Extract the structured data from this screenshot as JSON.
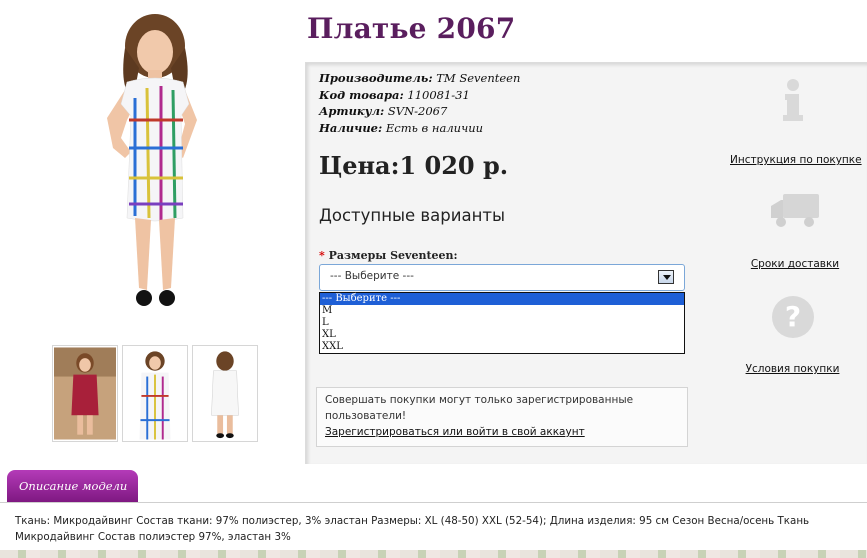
{
  "product": {
    "title": "Платье 2067",
    "specs": [
      {
        "label": "Производитель:",
        "value": " TM Seventeen"
      },
      {
        "label": "Код товара:",
        "value": " 110081-31"
      },
      {
        "label": "Артикул:",
        "value": " SVN-2067"
      },
      {
        "label": "Наличие:",
        "value": " Есть в наличии"
      }
    ],
    "price": "Цена:1 020 р."
  },
  "options": {
    "heading": "Доступные варианты",
    "required_mark": "*",
    "size_label": " Размеры Seventeen:",
    "selected": "--- Выберите ---",
    "list": [
      "--- Выберите ---",
      "M",
      "L",
      "XL",
      "XXL"
    ]
  },
  "notice": {
    "text": "Совершать покупки могут только зарегистрированные пользователи!",
    "link": "Зарегистрироваться или войти в свой аккаунт"
  },
  "side": {
    "instructions": "Инструкция по покупке",
    "delivery": "Сроки доставки",
    "terms": "Условия покупки",
    "icons": [
      "info-icon",
      "truck-icon",
      "question-icon"
    ]
  },
  "description": {
    "tab": "Описание модели",
    "text": "Ткань: Микродайвинг Состав ткани: 97% полиэстер, 3% эластан Размеры: XL (48-50) XXL (52-54); Длина изделия: 95 см Сезон Весна/осень Ткань Микродайвинг Состав полиэстер 97%, эластан 3%"
  },
  "colors": {
    "title": "#5a1e5e",
    "tab": "#9a2a9e",
    "select_highlight": "#1e5fd6"
  }
}
